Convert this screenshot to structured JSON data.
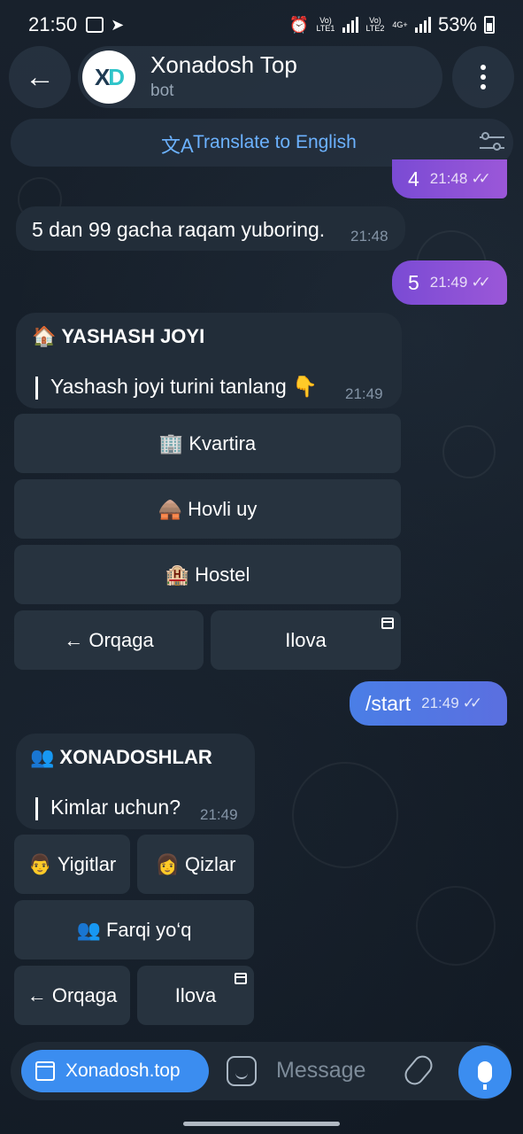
{
  "status_bar": {
    "time": "21:50",
    "battery": "53%",
    "sim1": "Vo) LTE1",
    "sim2": "Vo) LTE2",
    "network": "4G+"
  },
  "header": {
    "title": "Xonadosh Top",
    "subtitle": "bot",
    "avatar_text": "XD"
  },
  "translate": {
    "label": "Translate to English"
  },
  "messages": {
    "out_4": {
      "text": "4",
      "time": "21:48"
    },
    "in_range": {
      "text": "5 dan 99 gacha raqam yuboring.",
      "time": "21:48"
    },
    "out_5": {
      "text": "5",
      "time": "21:49"
    },
    "yashash": {
      "title_emoji": "🏠",
      "title": "YASHASH JOYI",
      "body": "Yashash joyi turini tanlang 👇",
      "time": "21:49",
      "buttons": {
        "kvartira": "🏢 Kvartira",
        "hovli": "🛖 Hovli uy",
        "hostel": "🏨 Hostel",
        "back": "← Orqaga",
        "ilova": "Ilova"
      }
    },
    "out_start": {
      "text": "/start",
      "time": "21:49"
    },
    "xonadoshlar": {
      "title_emoji": "👥",
      "title": "XONADOSHLAR",
      "body": "Kimlar uchun?",
      "time": "21:49",
      "buttons": {
        "yigitlar": "👨 Yigitlar",
        "qizlar": "👩 Qizlar",
        "farqi": "👥 Farqi yo‘q",
        "back": "← Orqaga",
        "ilova": "Ilova"
      }
    }
  },
  "input": {
    "app_button": "Xonadosh.top",
    "placeholder": "Message"
  }
}
